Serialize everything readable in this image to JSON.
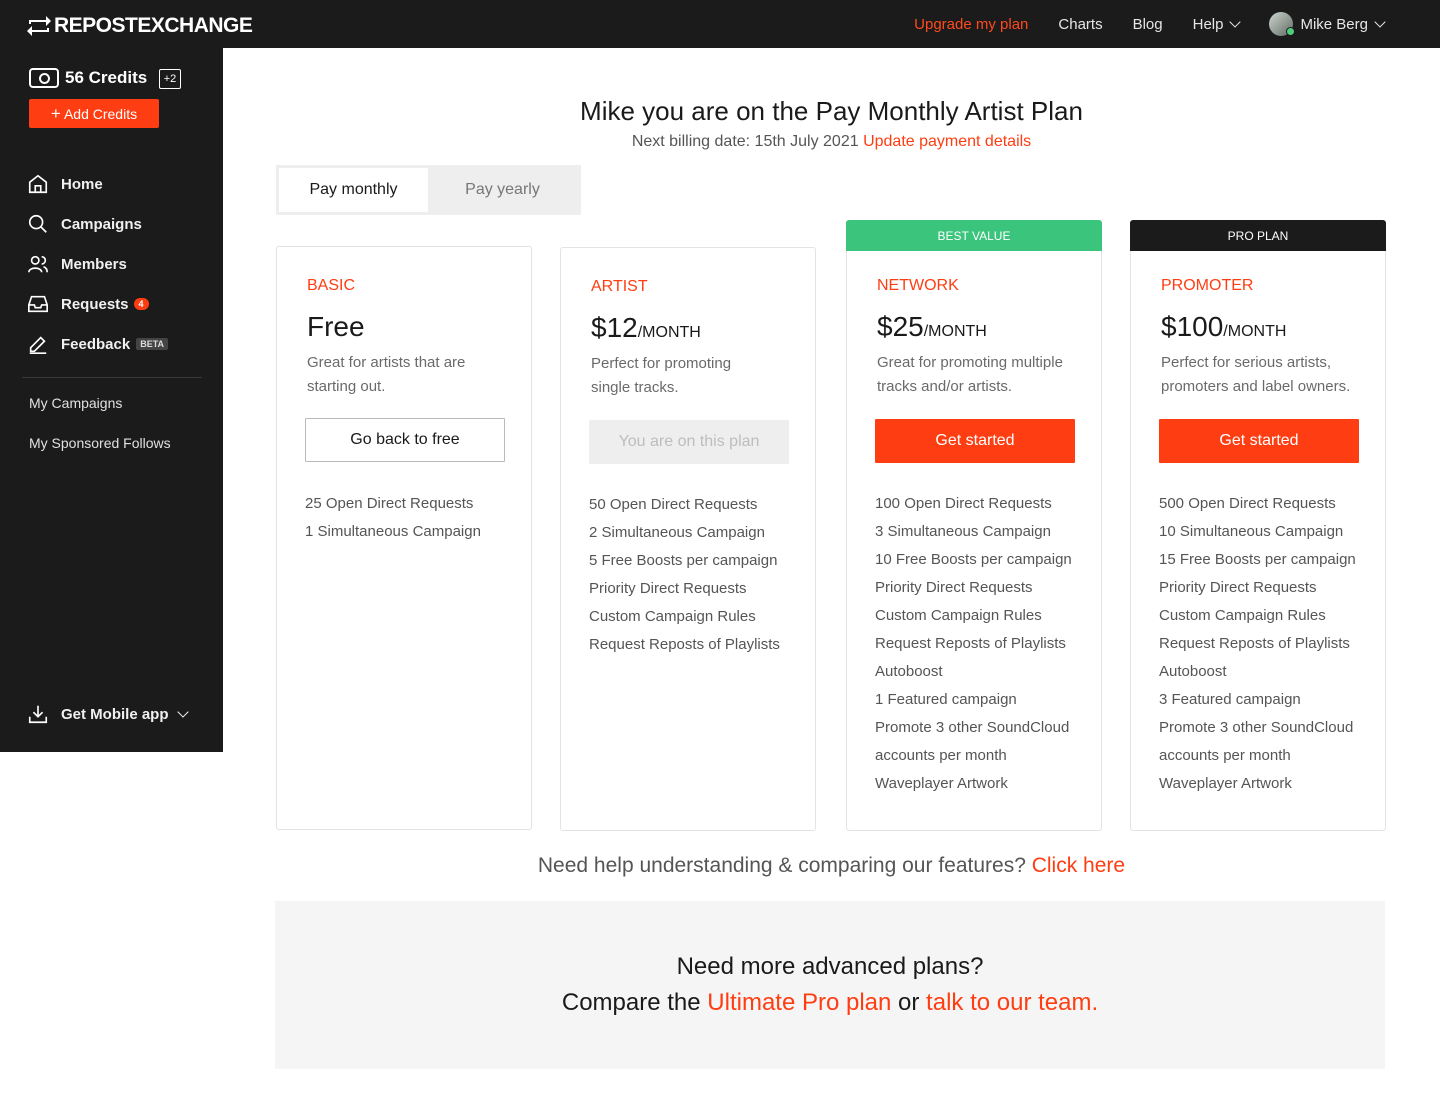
{
  "app": {
    "logo_text": "REPOSTEXCHANGE"
  },
  "nav": {
    "upgrade": "Upgrade my plan",
    "charts": "Charts",
    "blog": "Blog",
    "help": "Help",
    "user": "Mike Berg"
  },
  "sidebar": {
    "credits": "56 Credits",
    "credits_bonus": "+2",
    "add_credits": "Add Credits",
    "items": [
      {
        "label": "Home"
      },
      {
        "label": "Campaigns"
      },
      {
        "label": "Members"
      },
      {
        "label": "Requests",
        "badge": "4"
      },
      {
        "label": "Feedback",
        "badge": "BETA"
      }
    ],
    "sub_items": [
      {
        "label": "My Campaigns"
      },
      {
        "label": "My Sponsored Follows"
      }
    ],
    "mobile_app": "Get Mobile app"
  },
  "header": {
    "title": "Mike you are on the Pay Monthly Artist Plan",
    "billing_text": "Next billing date: 15th July 2021",
    "billing_link": "Update payment details"
  },
  "toggle": {
    "monthly": "Pay monthly",
    "yearly": "Pay yearly"
  },
  "plans": [
    {
      "name": "BASIC",
      "price": "Free",
      "per": "",
      "desc": "Great for artists that are starting out.",
      "button": "Go back to free",
      "features": [
        "25 Open Direct Requests",
        "1 Simultaneous Campaign"
      ]
    },
    {
      "name": "ARTIST",
      "price": "$12",
      "per": "/MONTH",
      "desc": "Perfect for promoting single tracks.",
      "button": "You are on this plan",
      "features": [
        "50 Open Direct Requests",
        "2 Simultaneous Campaign",
        "5 Free Boosts per campaign",
        "Priority Direct Requests",
        "Custom Campaign Rules",
        "Request Reposts of Playlists"
      ]
    },
    {
      "ribbon": "BEST VALUE",
      "name": "NETWORK",
      "price": "$25",
      "per": "/MONTH",
      "desc": "Great for promoting multiple tracks and/or artists.",
      "button": "Get started",
      "features": [
        "100 Open Direct Requests",
        "3 Simultaneous Campaign",
        "10 Free Boosts per campaign",
        "Priority Direct Requests",
        "Custom Campaign Rules",
        "Request Reposts of Playlists",
        "Autoboost",
        "1 Featured campaign",
        "Promote 3 other SoundCloud",
        "accounts per month",
        "Waveplayer Artwork"
      ]
    },
    {
      "ribbon": "PRO PLAN",
      "name": "PROMOTER",
      "price": "$100",
      "per": "/MONTH",
      "desc": "Perfect for serious artists, promoters and label owners.",
      "button": "Get started",
      "features": [
        "500 Open Direct Requests",
        "10 Simultaneous Campaign",
        "15 Free Boosts per campaign",
        "Priority Direct Requests",
        "Custom Campaign Rules",
        "Request Reposts of Playlists",
        "Autoboost",
        "3 Featured campaign",
        "Promote 3 other SoundCloud",
        "accounts per month",
        "Waveplayer Artwork"
      ]
    }
  ],
  "help": {
    "text": "Need help understanding & comparing our features?",
    "link": "Click here"
  },
  "advanced": {
    "line1": "Need more advanced plans?",
    "prefix": "Compare the",
    "link1": "Ultimate Pro plan",
    "middle": "or",
    "link2": "talk to our team."
  },
  "colors": {
    "accent": "#ff3d12",
    "best_value": "#3bc47c",
    "dark": "#1b1b1b"
  }
}
